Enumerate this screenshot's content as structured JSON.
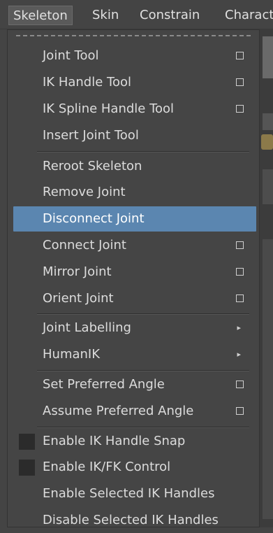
{
  "menubar": {
    "items": [
      "Skeleton",
      "Skin",
      "Constrain",
      "Characte"
    ]
  },
  "menu": {
    "items": [
      {
        "label": "Joint Tool",
        "option": true
      },
      {
        "label": "IK Handle Tool",
        "option": true
      },
      {
        "label": "IK Spline Handle Tool",
        "option": true
      },
      {
        "label": "Insert Joint Tool",
        "option": false
      },
      {
        "label": "Reroot Skeleton",
        "option": false
      },
      {
        "label": "Remove Joint",
        "option": false
      },
      {
        "label": "Disconnect Joint",
        "option": false,
        "highlighted": true
      },
      {
        "label": "Connect Joint",
        "option": true
      },
      {
        "label": "Mirror Joint",
        "option": true
      },
      {
        "label": "Orient Joint",
        "option": true
      },
      {
        "label": "Joint Labelling",
        "submenu": true
      },
      {
        "label": "HumanIK",
        "submenu": true
      },
      {
        "label": "Set Preferred Angle",
        "option": true
      },
      {
        "label": "Assume Preferred Angle",
        "option": true
      },
      {
        "label": "Enable IK Handle Snap",
        "checkbox": true
      },
      {
        "label": "Enable IK/FK Control",
        "checkbox": true
      },
      {
        "label": "Enable Selected IK Handles"
      },
      {
        "label": "Disable Selected IK Handles"
      }
    ],
    "submenu_glyph": "▸"
  },
  "colors": {
    "menu_background": "#454545",
    "highlight": "#5b86b0"
  }
}
